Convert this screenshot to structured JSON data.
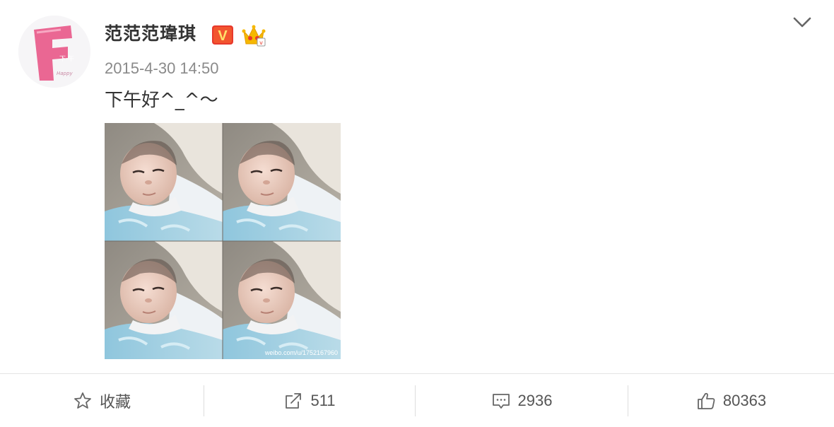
{
  "post": {
    "author": {
      "name": "范范范瑋琪",
      "verified_badge": "V",
      "avatar_icon": "avatar-pink-f-logo",
      "avatar_logo_text": "F"
    },
    "timestamp": "2015-4-30 14:50",
    "text": "下午好^_^～",
    "image": {
      "description_icon": "baby-photo-grid",
      "watermark": "weibo.com/u/1752167960"
    },
    "menu_icon": "chevron-down-icon"
  },
  "actions": {
    "favorite": {
      "label": "收藏",
      "icon": "star-icon"
    },
    "repost": {
      "count": "511",
      "icon": "share-icon"
    },
    "comment": {
      "count": "2936",
      "icon": "comment-icon"
    },
    "like": {
      "count": "80363",
      "icon": "thumbs-up-icon"
    }
  },
  "colors": {
    "text": "#333333",
    "muted": "#8a8a8a",
    "icon": "#666666",
    "vip_red": "#e8392c",
    "crown_yellow": "#f6b800",
    "avatar_pink": "#e85a8a"
  }
}
